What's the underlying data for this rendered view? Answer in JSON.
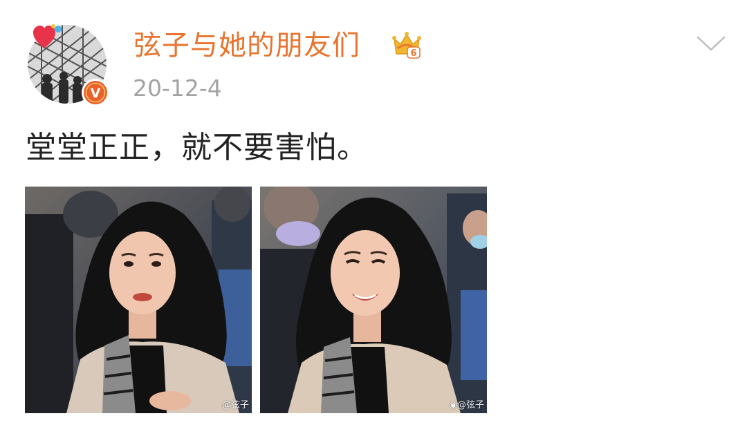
{
  "post": {
    "username": "弦子与她的朋友们",
    "date": "20-12-4",
    "text": "堂堂正正，就不要害怕。",
    "crown_level": "6",
    "verified_mark": "V"
  },
  "icons": {
    "avatar": "avatar-icon",
    "heart": "heart-icon",
    "verified": "verified-icon",
    "crown": "crown-icon",
    "menu": "chevron-down-icon",
    "weibo": "weibo-icon"
  },
  "photos": [
    {
      "watermark": "@弦子"
    },
    {
      "watermark": "@弦子"
    }
  ],
  "colors": {
    "username": "#e8742f",
    "date": "#a3a3a3",
    "text": "#222222",
    "verified_badge": "#e8622a",
    "crown": "#f2b72e"
  }
}
